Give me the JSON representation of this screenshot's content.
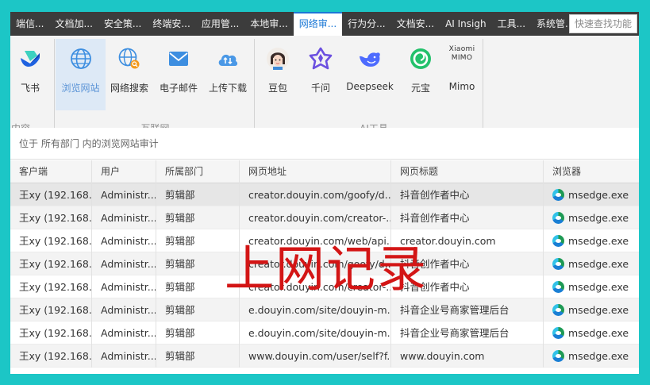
{
  "menu": {
    "tabs": [
      "端信...",
      "文档加...",
      "安全策...",
      "终端安...",
      "应用管...",
      "本地审...",
      "网络审...",
      "行为分...",
      "文档安...",
      "AI Insigh",
      "工具...",
      "系统管..."
    ],
    "active_index": 6,
    "search_placeholder": "快速查找功能"
  },
  "ribbon": {
    "group_partial_label": "内容",
    "feishu_label": "飞书",
    "internet": {
      "label": "互联网",
      "buttons": [
        "浏览网站",
        "网络搜索",
        "电子邮件",
        "上传下载"
      ]
    },
    "ai": {
      "label": "AI工具",
      "buttons": [
        "豆包",
        "千问",
        "Deepseek",
        "元宝",
        "Mimo"
      ],
      "mimo_logo_text": "Xiaomi\nMIMO"
    },
    "accent_color": "#1b78d6"
  },
  "path_text": "位于 所有部门 内的浏览网站审计",
  "table": {
    "columns": [
      "客户端",
      "用户",
      "所属部门",
      "网页地址",
      "网页标题",
      "浏览器"
    ],
    "rows": [
      [
        "王xy (192.168....",
        "Administr...",
        "剪辑部",
        "creator.douyin.com/goofy/d...",
        "抖音创作者中心",
        "msedge.exe"
      ],
      [
        "王xy (192.168....",
        "Administr...",
        "剪辑部",
        "creator.douyin.com/creator-...",
        "抖音创作者中心",
        "msedge.exe"
      ],
      [
        "王xy (192.168....",
        "Administr...",
        "剪辑部",
        "creator.douyin.com/web/api...",
        "creator.douyin.com",
        "msedge.exe"
      ],
      [
        "王xy (192.168....",
        "Administr...",
        "剪辑部",
        "creator.douyin.com/goofy/d...",
        "抖音创作者中心",
        "msedge.exe"
      ],
      [
        "王xy (192.168....",
        "Administr...",
        "剪辑部",
        "creator.douyin.com/creator-...",
        "抖音创作者中心",
        "msedge.exe"
      ],
      [
        "王xy (192.168....",
        "Administr...",
        "剪辑部",
        "e.douyin.com/site/douyin-m...",
        "抖音企业号商家管理后台",
        "msedge.exe"
      ],
      [
        "王xy (192.168....",
        "Administr...",
        "剪辑部",
        "e.douyin.com/site/douyin-m...",
        "抖音企业号商家管理后台",
        "msedge.exe"
      ],
      [
        "王xy (192.168....",
        "Administr...",
        "剪辑部",
        "www.douyin.com/user/self?f...",
        "www.douyin.com",
        "msedge.exe"
      ]
    ]
  },
  "overlay_caption": "上网记录",
  "colors": {
    "frame_border": "#1cc6c6",
    "caption": "#d31515"
  }
}
